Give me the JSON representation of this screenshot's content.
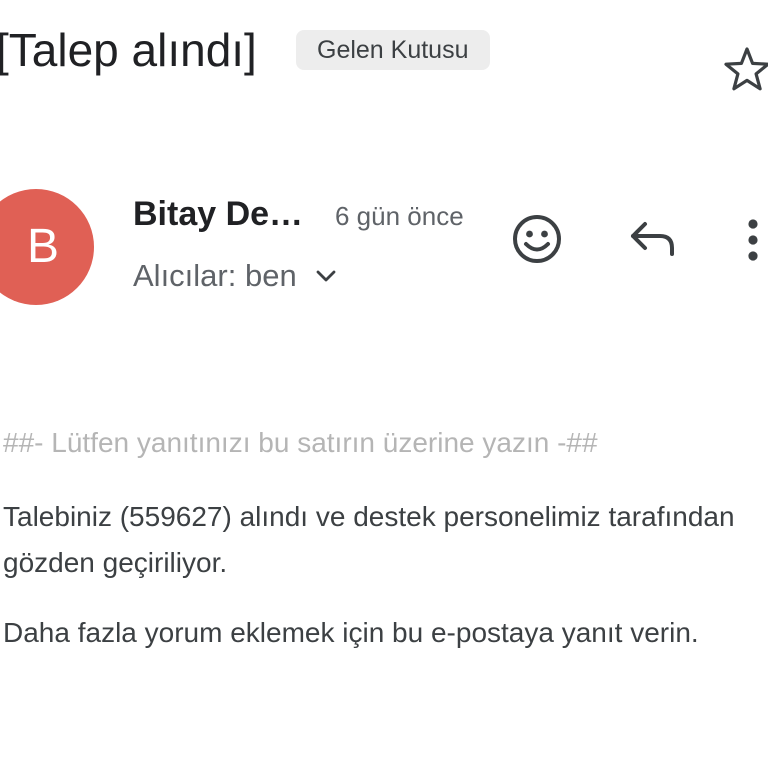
{
  "email": {
    "subject": "[Talep alındı]",
    "label": "Gelen Kutusu",
    "sender": {
      "initial": "B",
      "name": "Bitay De…",
      "time": "6 gün önce",
      "recipients": "Alıcılar: ben",
      "avatar_color": "#e06055"
    },
    "body": {
      "reply_marker": "##- Lütfen yanıtınızı bu satırın üzerine yazın -##",
      "paragraph_1": "Talebiniz (559627) alındı ve destek personelimiz tarafından gözden geçiriliyor.",
      "paragraph_2": "Daha fazla yorum eklemek için bu e-postaya yanıt verin."
    }
  },
  "icons": {
    "star": "star-outline-icon",
    "chevron": "chevron-down-icon",
    "emoji": "smiley-icon",
    "reply": "reply-icon",
    "more": "more-vert-icon"
  }
}
